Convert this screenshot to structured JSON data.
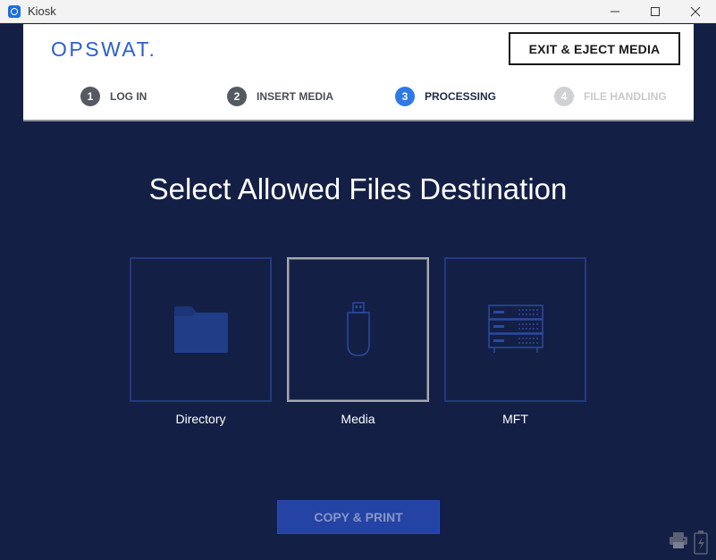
{
  "window": {
    "title": "Kiosk"
  },
  "header": {
    "logo_text": "OPSWAT.",
    "exit_button": "EXIT & EJECT MEDIA",
    "steps": [
      {
        "num": "1",
        "label": "LOG IN",
        "state": "done"
      },
      {
        "num": "2",
        "label": "INSERT MEDIA",
        "state": "done"
      },
      {
        "num": "3",
        "label": "PROCESSING",
        "state": "active"
      },
      {
        "num": "4",
        "label": "FILE HANDLING",
        "state": "todo"
      }
    ]
  },
  "main": {
    "title": "Select Allowed Files Destination",
    "options": [
      {
        "label": "Directory",
        "icon": "folder-icon",
        "selected": false
      },
      {
        "label": "Media",
        "icon": "usb-drive-icon",
        "selected": true
      },
      {
        "label": "MFT",
        "icon": "server-icon",
        "selected": false
      }
    ],
    "copy_print_button": "COPY & PRINT"
  },
  "status_icons": [
    "printer-icon",
    "battery-icon"
  ],
  "colors": {
    "background": "#141f45",
    "accent": "#2f78e8",
    "card_border": "#223a80",
    "button": "#2543a4"
  }
}
